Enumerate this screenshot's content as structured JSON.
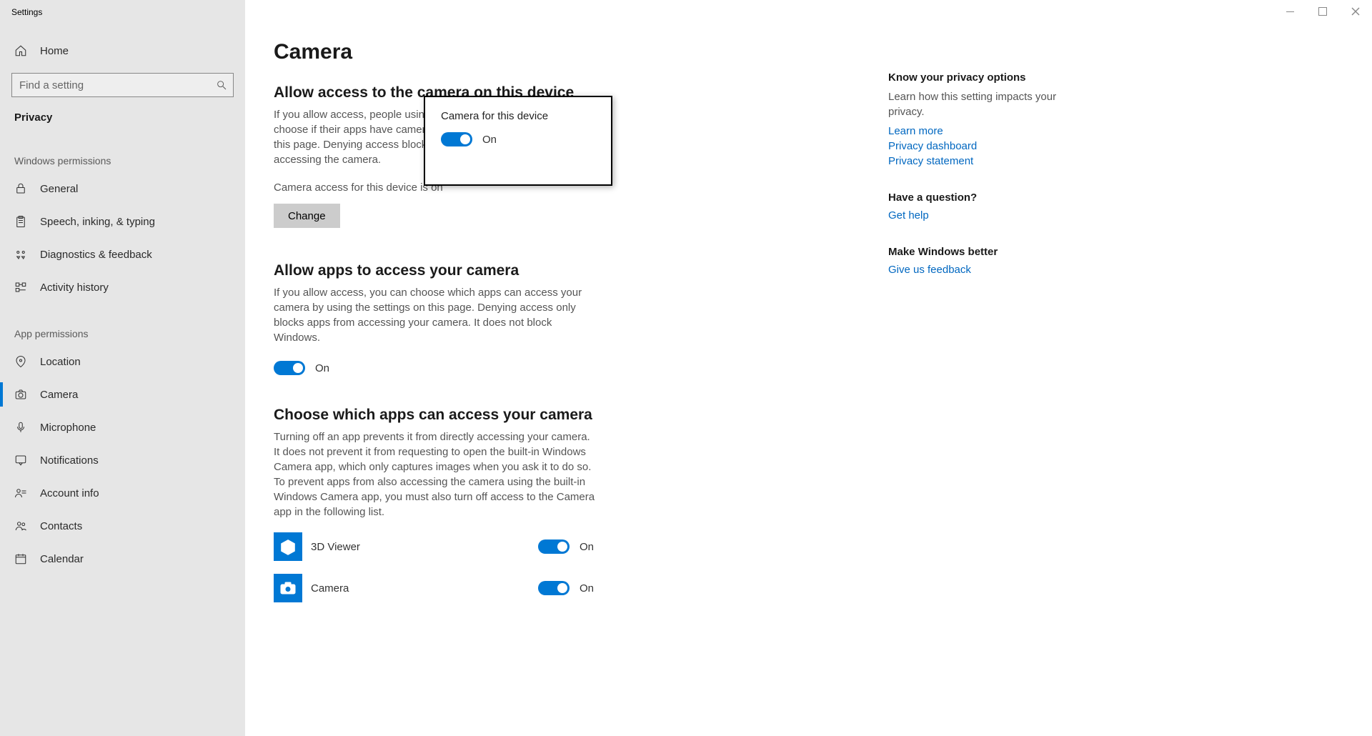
{
  "window": {
    "title": "Settings"
  },
  "sidebar": {
    "home": "Home",
    "searchPlaceholder": "Find a setting",
    "category": "Privacy",
    "winPermLabel": "Windows permissions",
    "appPermLabel": "App permissions",
    "winItems": [
      {
        "label": "General"
      },
      {
        "label": "Speech, inking, & typing"
      },
      {
        "label": "Diagnostics & feedback"
      },
      {
        "label": "Activity history"
      }
    ],
    "appItems": [
      {
        "label": "Location"
      },
      {
        "label": "Camera"
      },
      {
        "label": "Microphone"
      },
      {
        "label": "Notifications"
      },
      {
        "label": "Account info"
      },
      {
        "label": "Contacts"
      },
      {
        "label": "Calendar"
      }
    ]
  },
  "popup": {
    "title": "Camera for this device",
    "state": "On"
  },
  "main": {
    "pageTitle": "Camera",
    "sec1": {
      "heading": "Allow access to the camera on this device",
      "desc": "If you allow access, people using this device will be able to choose if their apps have camera access by using the settings on this page. Denying access blocks Windows and apps from accessing the camera.",
      "statusPrefix": "Camera access for this device is ",
      "statusValue": "on",
      "changeBtn": "Change"
    },
    "sec2": {
      "heading": "Allow apps to access your camera",
      "desc": "If you allow access, you can choose which apps can access your camera by using the settings on this page. Denying access only blocks apps from accessing your camera. It does not block Windows.",
      "toggleState": "On"
    },
    "sec3": {
      "heading": "Choose which apps can access your camera",
      "desc": "Turning off an app prevents it from directly accessing your camera. It does not prevent it from requesting to open the built-in Windows Camera app, which only captures images when you ask it to do so. To prevent apps from also accessing the camera using the built-in Windows Camera app, you must also turn off access to the Camera app in the following list."
    },
    "apps": [
      {
        "name": "3D Viewer",
        "state": "On"
      },
      {
        "name": "Camera",
        "state": "On"
      }
    ]
  },
  "info": {
    "h1": "Know your privacy options",
    "t1": "Learn how this setting impacts your privacy.",
    "l1": "Learn more",
    "l2": "Privacy dashboard",
    "l3": "Privacy statement",
    "h2": "Have a question?",
    "l4": "Get help",
    "h3": "Make Windows better",
    "l5": "Give us feedback"
  }
}
